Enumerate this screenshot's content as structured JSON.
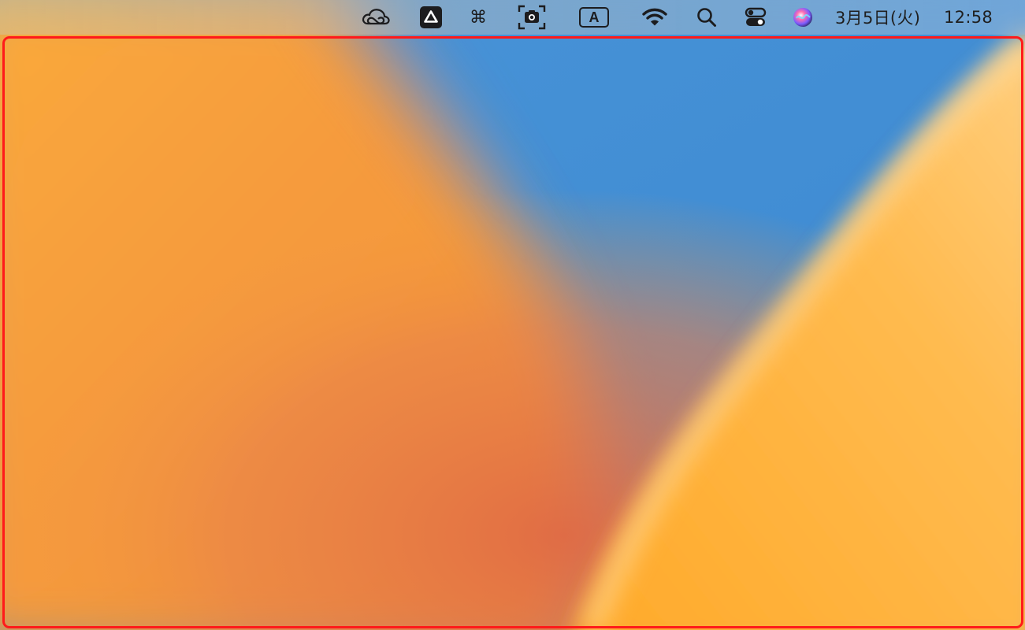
{
  "menubar": {
    "status_items": [
      {
        "icon": "creative-cloud-icon"
      },
      {
        "icon": "google-drive-icon"
      },
      {
        "icon": "command-icon",
        "glyph": "⌘"
      },
      {
        "icon": "screenshot-icon"
      },
      {
        "icon": "input-source-icon",
        "glyph": "A"
      },
      {
        "icon": "wifi-icon"
      },
      {
        "icon": "spotlight-search-icon"
      },
      {
        "icon": "control-center-icon"
      },
      {
        "icon": "siri-icon"
      }
    ],
    "clock": {
      "date": "3月5日(火)",
      "time": "12:58"
    }
  },
  "highlight": {
    "color": "#ff1a1a"
  },
  "wallpaper": {
    "colors": {
      "orange_left": "#f7a23a",
      "coral_mid": "#e2704a",
      "blue": "#3a8fd6",
      "yellow_right": "#ffb43c"
    }
  }
}
